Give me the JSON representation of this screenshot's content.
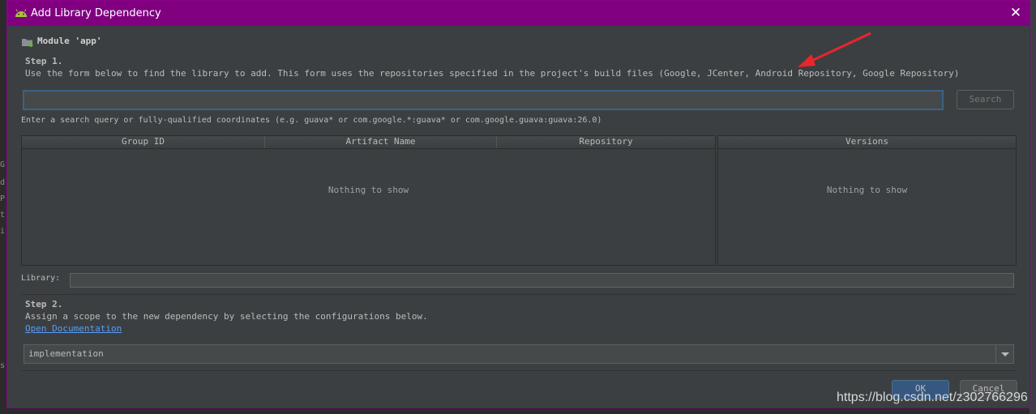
{
  "window": {
    "title": "Add Library Dependency",
    "close_glyph": "✕"
  },
  "module": {
    "label": "Module 'app'"
  },
  "step1": {
    "title": "Step 1.",
    "description": "Use the form below to find the library to add. This form uses the repositories specified in the project's build files (Google, JCenter, Android Repository, Google Repository)"
  },
  "search": {
    "value": "",
    "button_label": "Search",
    "hint": "Enter a search query or fully-qualified coordinates (e.g. guava* or com.google.*:guava* or com.google.guava:guava:26.0)"
  },
  "results_table": {
    "columns": [
      "Group ID",
      "Artifact Name",
      "Repository"
    ],
    "empty_text": "Nothing to show"
  },
  "versions_table": {
    "columns": [
      "Versions"
    ],
    "empty_text": "Nothing to show"
  },
  "library": {
    "label": "Library:",
    "value": ""
  },
  "step2": {
    "title": "Step 2.",
    "description": "Assign a scope to the new dependency by selecting the configurations below.",
    "doc_link": "Open Documentation"
  },
  "scope": {
    "selected": "implementation"
  },
  "buttons": {
    "ok": "OK",
    "cancel": "Cancel"
  },
  "background_editor": {
    "glyphs": [
      "G",
      "d",
      "P",
      "t",
      "i",
      "s"
    ]
  },
  "watermark": "https://blog.csdn.net/z302766296",
  "colors": {
    "titlebar": "#800080",
    "dialog_bg": "#3c3f41",
    "link": "#589df6",
    "ok_button": "#365880",
    "annotation_arrow": "#e8262b"
  },
  "icons": {
    "app": "android-icon",
    "module": "module-folder-icon",
    "close": "close-icon",
    "dropdown": "chevron-down-icon"
  }
}
